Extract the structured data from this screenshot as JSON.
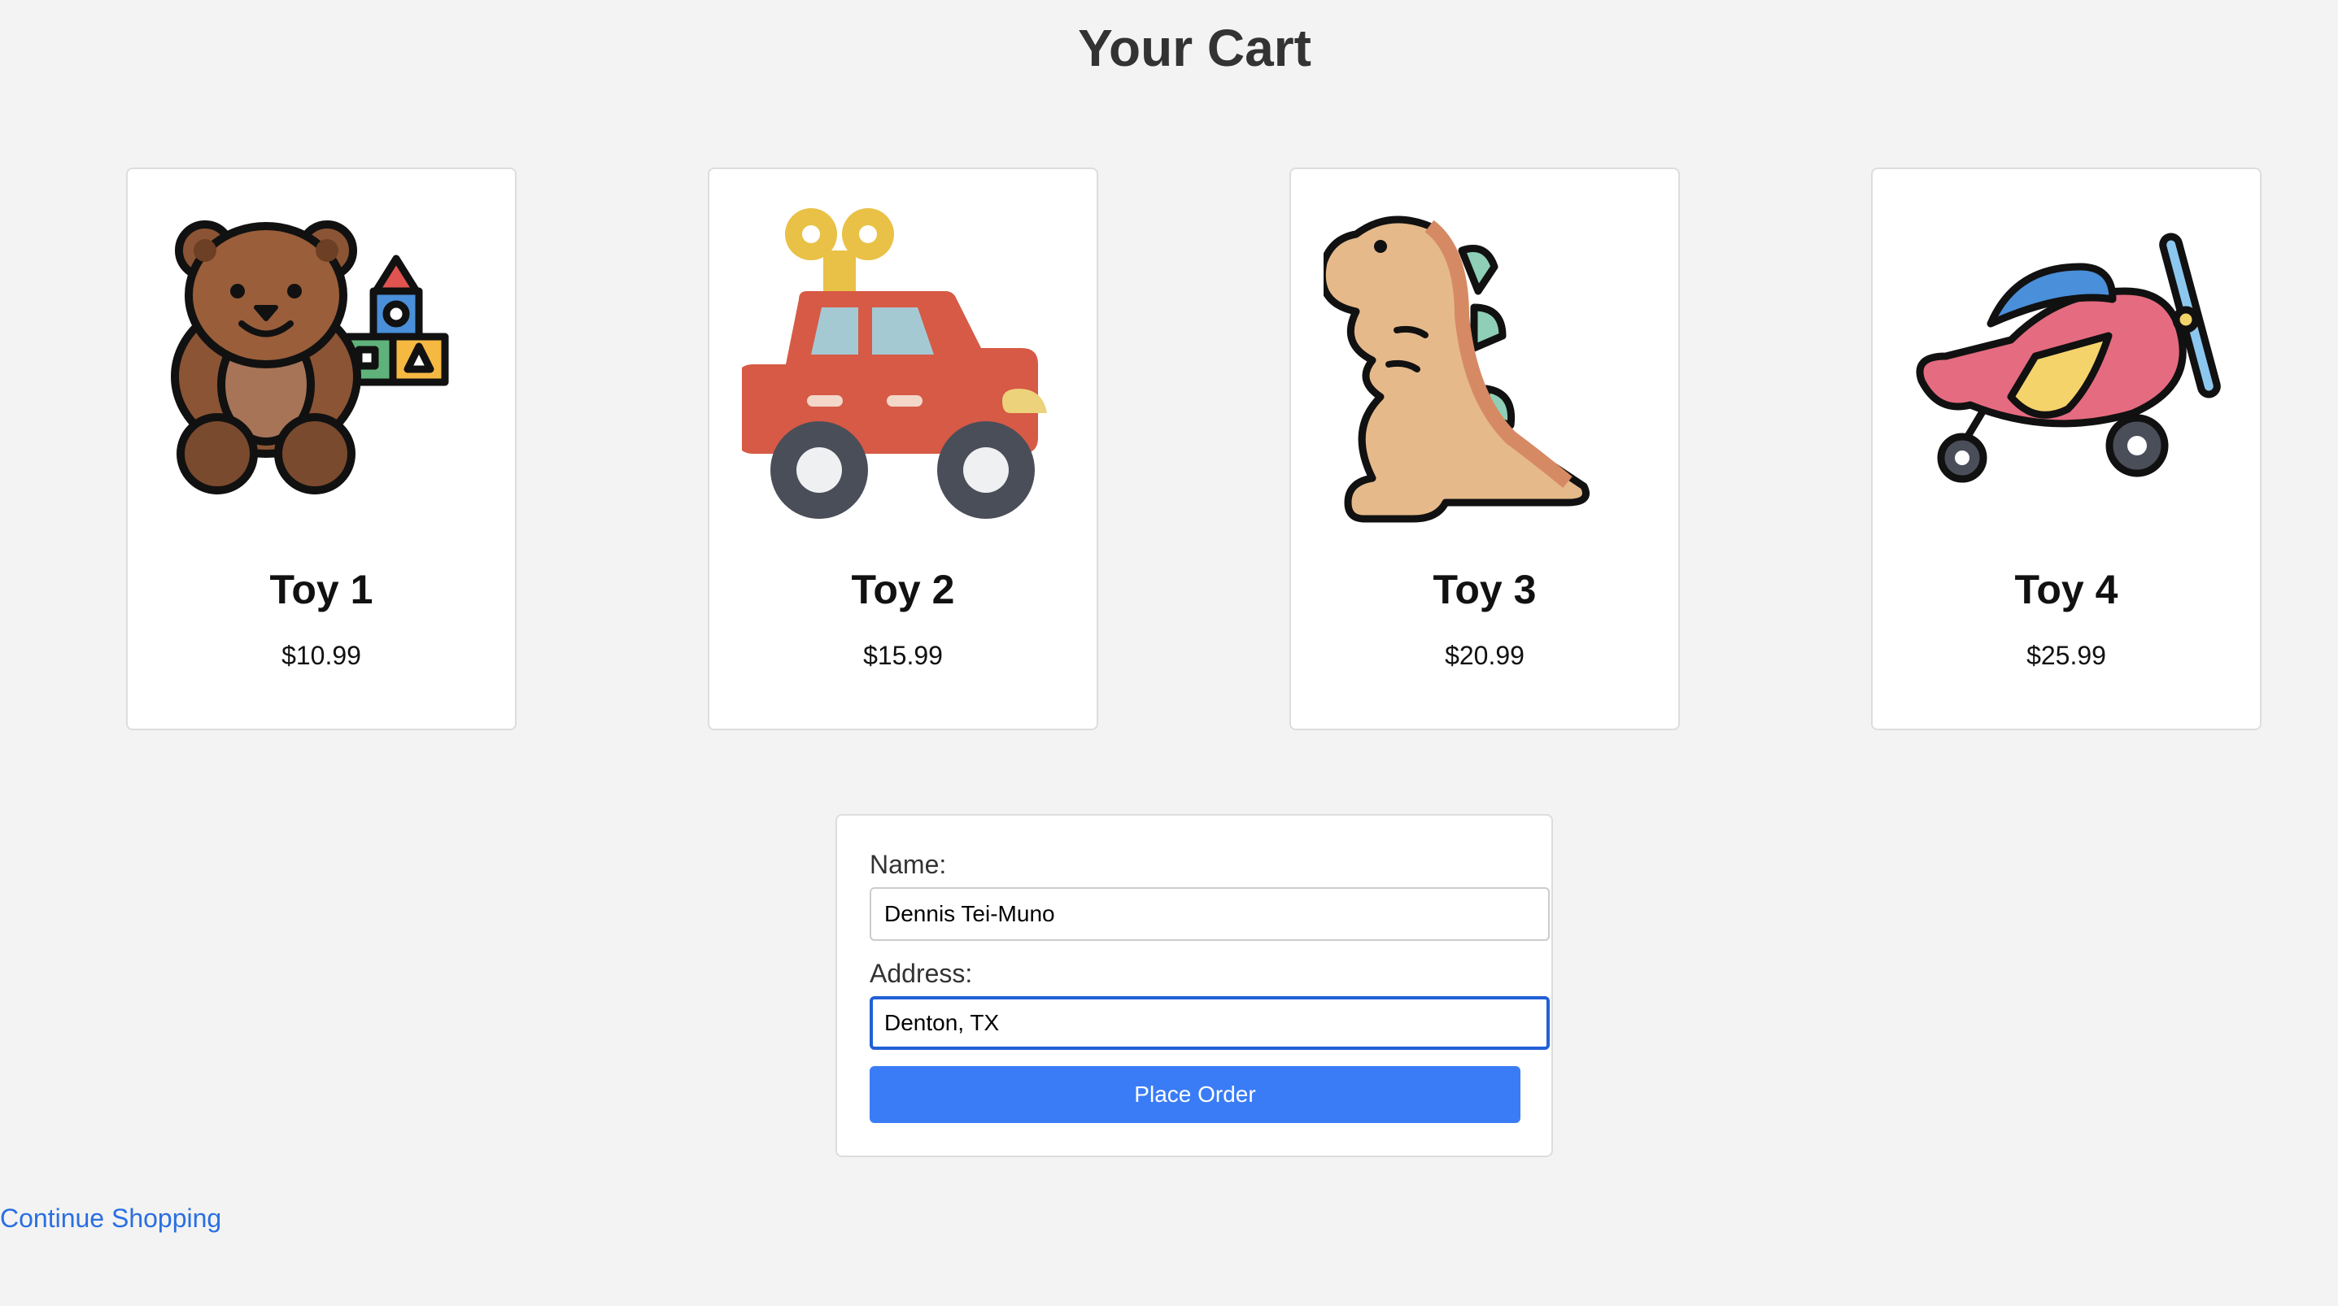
{
  "page": {
    "title": "Your Cart"
  },
  "cart": {
    "items": [
      {
        "name": "Toy 1",
        "price": "$10.99",
        "image_icon": "teddy-bear-with-blocks-icon"
      },
      {
        "name": "Toy 2",
        "price": "$15.99",
        "image_icon": "wind-up-car-icon"
      },
      {
        "name": "Toy 3",
        "price": "$20.99",
        "image_icon": "toy-dinosaur-icon"
      },
      {
        "name": "Toy 4",
        "price": "$25.99",
        "image_icon": "toy-airplane-icon"
      }
    ]
  },
  "order_form": {
    "name_label": "Name:",
    "name_value": "Dennis Tei-Muno",
    "address_label": "Address:",
    "address_value": "Denton, TX",
    "submit_label": "Place Order"
  },
  "links": {
    "continue_shopping": "Continue Shopping"
  },
  "colors": {
    "background": "#f3f3f3",
    "button": "#3a7cf6",
    "link": "#2a6fe0",
    "focus_border": "#2160d6"
  }
}
